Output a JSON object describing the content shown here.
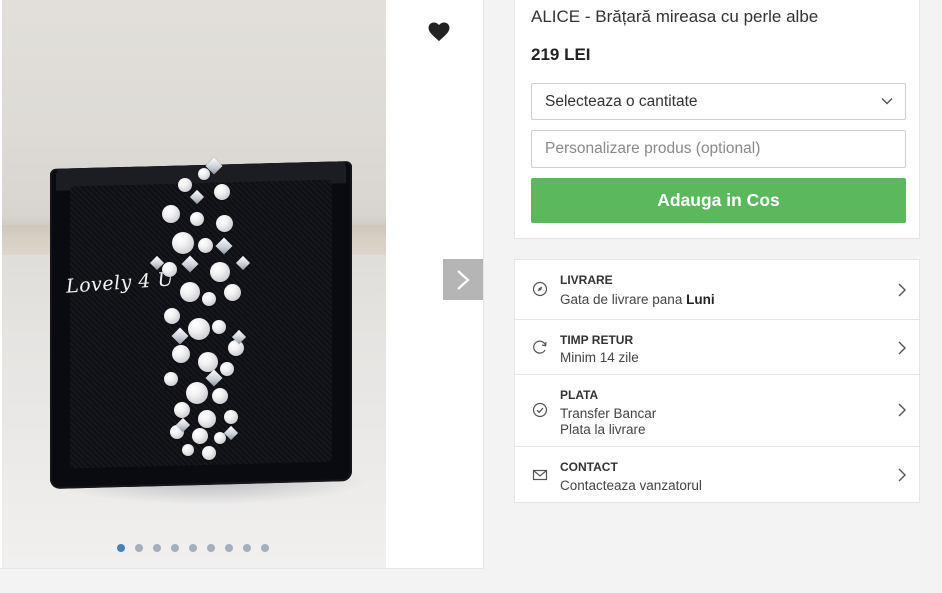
{
  "product": {
    "title": "ALICE - Brățară mireasa cu perle albe",
    "price": "219 LEI",
    "quantity_select": "Selecteaza o cantitate",
    "personalize_placeholder": "Personalizare produs (optional)",
    "add_to_cart": "Adauga in Cos",
    "accent_color": "#5cb85c"
  },
  "gallery": {
    "watermark": "Lovely 4 U",
    "dots_count": 9,
    "active_dot": 1,
    "favorite_icon": "heart-icon",
    "next_icon": "chevron-right-icon"
  },
  "info": {
    "delivery": {
      "heading": "LIVRARE",
      "text_prefix": "Gata de livrare pana ",
      "text_bold": "Luni",
      "icon": "compass-icon"
    },
    "returns": {
      "heading": "TIMP RETUR",
      "text": "Minim 14 zile",
      "icon": "refresh-icon"
    },
    "payment": {
      "heading": "PLATA",
      "line1": "Transfer Bancar",
      "line2": "Plata la livrare",
      "icon": "check-circle-icon"
    },
    "contact": {
      "heading": "CONTACT",
      "text": "Contacteaza vanzatorul",
      "icon": "envelope-icon"
    }
  }
}
